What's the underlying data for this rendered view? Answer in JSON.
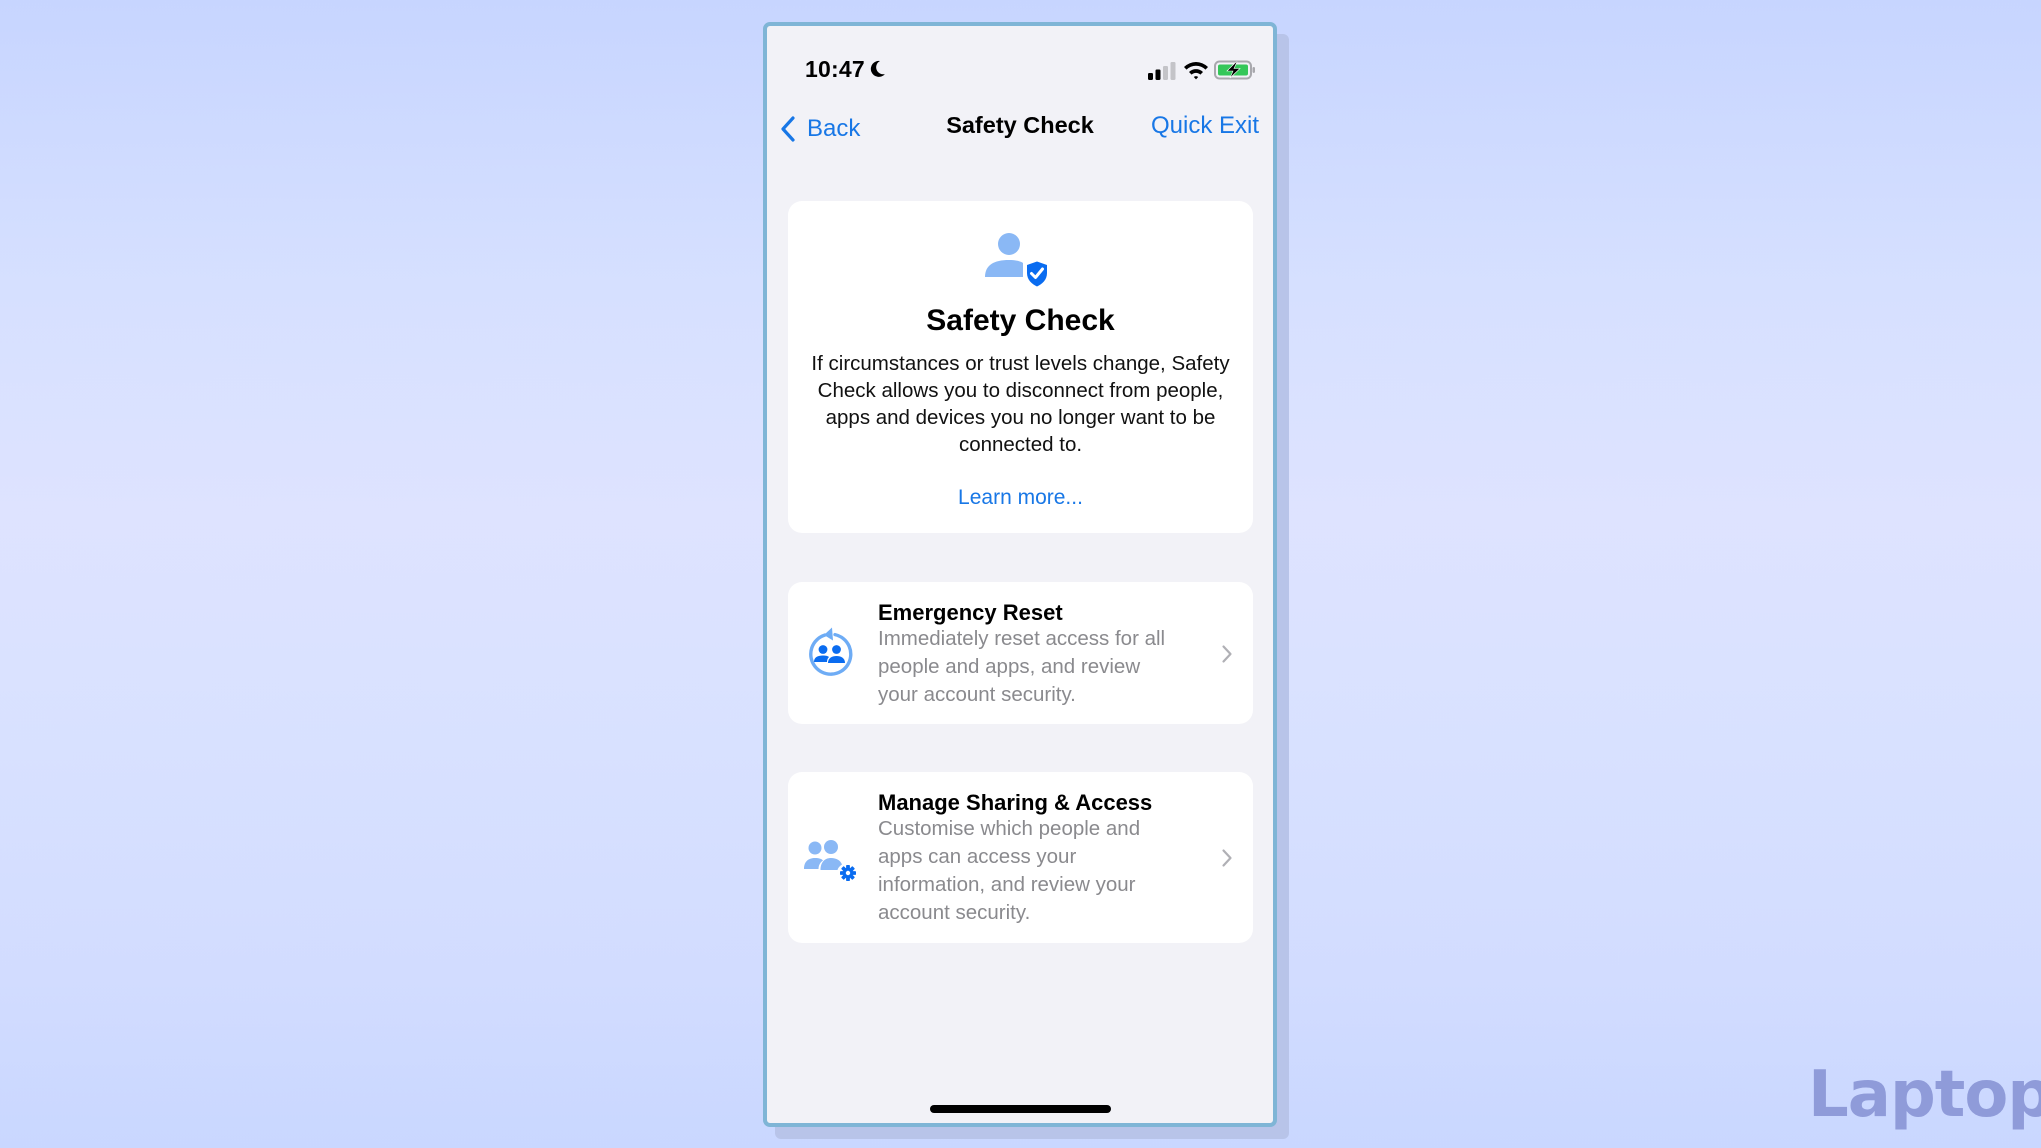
{
  "status_bar": {
    "time": "10:47",
    "focus_icon": "moon-icon",
    "signal_bars_filled": 2,
    "signal_bars_total": 4,
    "wifi_icon": "wifi-icon",
    "battery_icon": "battery-charging-icon",
    "battery_color": "#34c759"
  },
  "nav": {
    "back_label": "Back",
    "title": "Safety Check",
    "quick_exit_label": "Quick Exit"
  },
  "intro": {
    "icon": "person-shield-check-icon",
    "title": "Safety Check",
    "description": "If circumstances or trust levels change, Safety Check allows you to disconnect from people, apps and devices you no longer want to be connected to.",
    "learn_more": "Learn more..."
  },
  "options": [
    {
      "icon": "emergency-reset-icon",
      "title": "Emergency Reset",
      "description": "Immediately reset access for all people and apps, and review your account security."
    },
    {
      "icon": "people-gear-icon",
      "title": "Manage Sharing & Access",
      "description": "Customise which people and apps can access your information, and review your account security."
    }
  ],
  "colors": {
    "accent": "#1877e6",
    "icon_light": "#8ab8f5",
    "icon_dark": "#0a6cf0",
    "screen_bg": "#f2f2f7",
    "secondary_text": "#8a8a8e"
  },
  "watermark": "Laptop"
}
